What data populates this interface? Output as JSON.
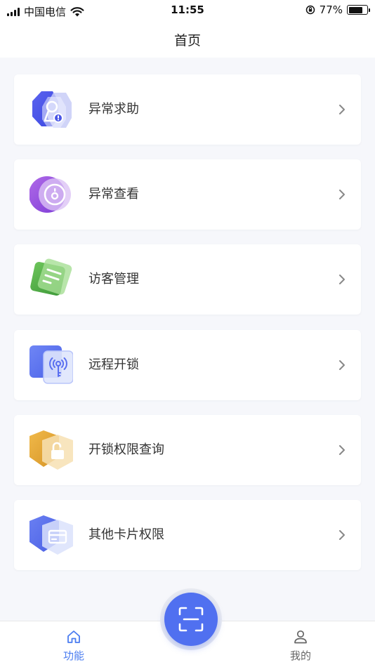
{
  "status_bar": {
    "carrier": "中国电信",
    "time": "11:55",
    "battery": "77%",
    "battery_level": 0.77
  },
  "header": {
    "title": "首页"
  },
  "menu": {
    "items": [
      {
        "label": "异常求助",
        "icon": "alert-help-icon"
      },
      {
        "label": "异常查看",
        "icon": "alert-view-icon"
      },
      {
        "label": "访客管理",
        "icon": "visitor-icon"
      },
      {
        "label": "远程开锁",
        "icon": "remote-unlock-icon"
      },
      {
        "label": "开锁权限查询",
        "icon": "unlock-permission-icon"
      },
      {
        "label": "其他卡片权限",
        "icon": "card-permission-icon"
      }
    ]
  },
  "tabbar": {
    "home_label": "功能",
    "mine_label": "我的",
    "active_color": "#4a7cf0",
    "scan_color": "#5070f0"
  }
}
